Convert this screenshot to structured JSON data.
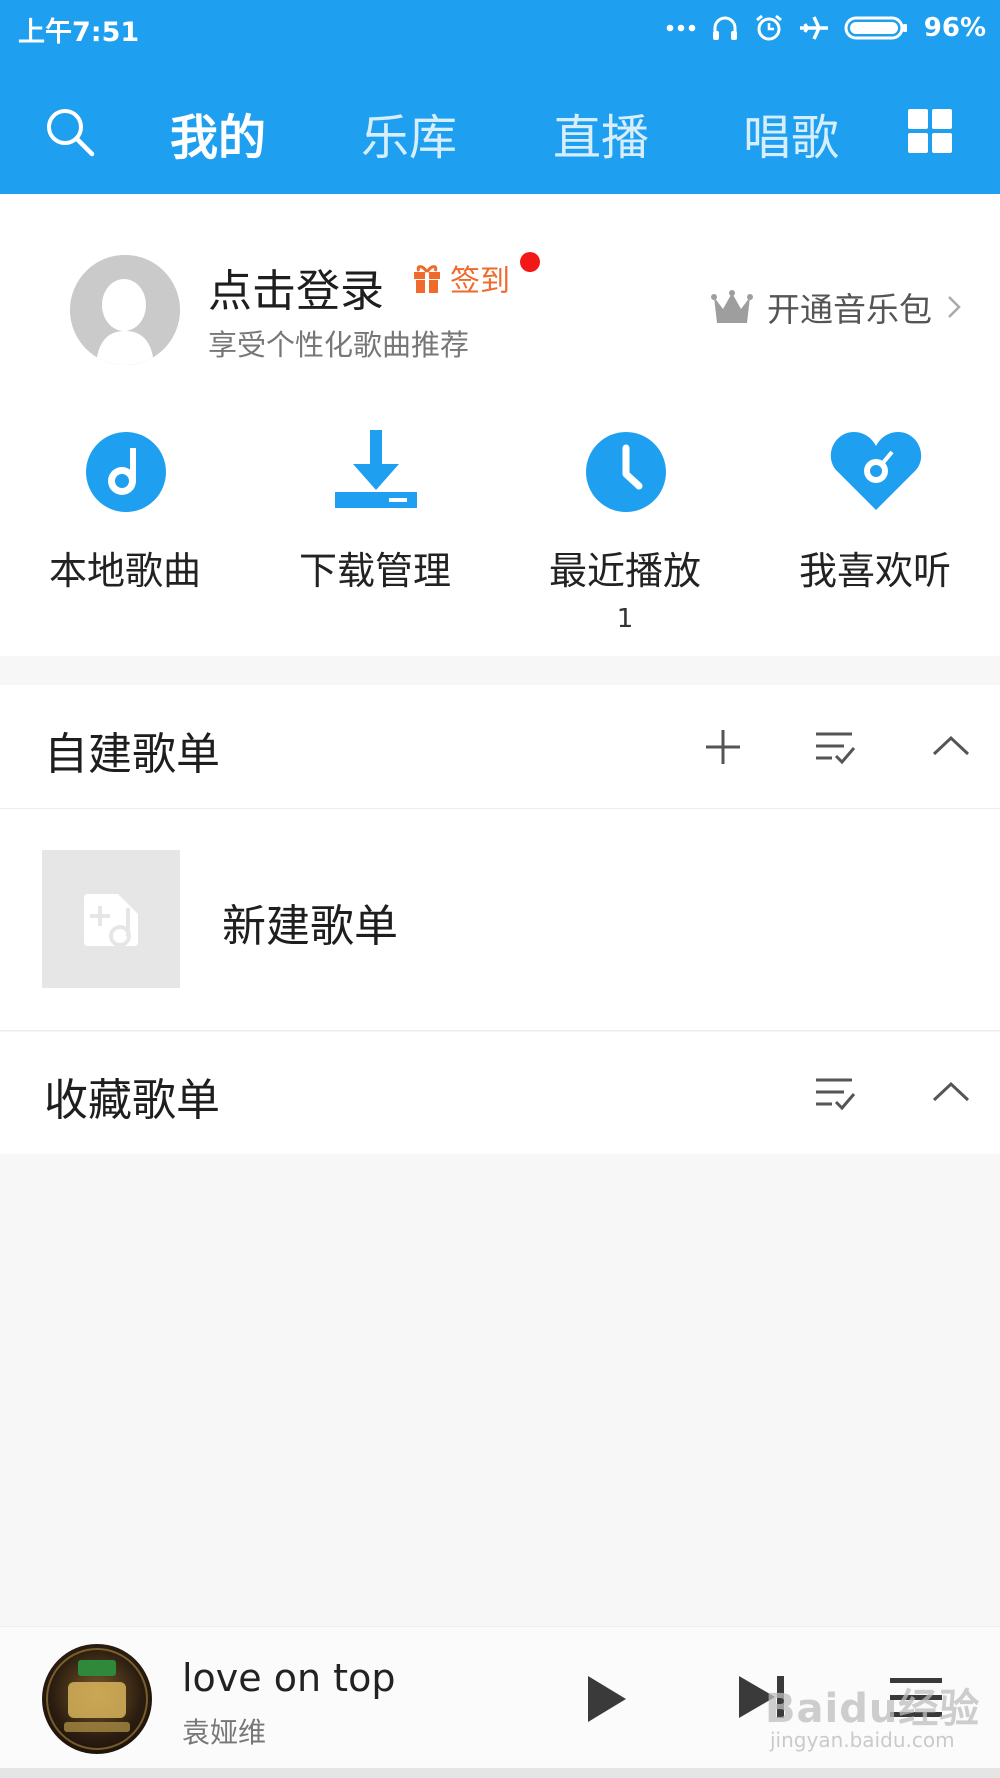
{
  "status_bar": {
    "time": "上午7:51",
    "battery": "96%"
  },
  "nav": {
    "tabs": [
      {
        "label": "我的",
        "active": true
      },
      {
        "label": "乐库",
        "active": false
      },
      {
        "label": "直播",
        "active": false
      },
      {
        "label": "唱歌",
        "active": false
      }
    ],
    "search_icon": "search-icon",
    "menu_icon": "grid-icon"
  },
  "profile": {
    "login_label": "点击登录",
    "signin_label": "签到",
    "subtitle": "享受个性化歌曲推荐",
    "vip_label": "开通音乐包"
  },
  "quick_entries": [
    {
      "label": "本地歌曲",
      "icon": "music-note-disc-icon",
      "count": ""
    },
    {
      "label": "下载管理",
      "icon": "download-icon",
      "count": ""
    },
    {
      "label": "最近播放",
      "icon": "clock-icon",
      "count": "1"
    },
    {
      "label": "我喜欢听",
      "icon": "heart-icon",
      "count": ""
    }
  ],
  "self_playlists": {
    "title": "自建歌单",
    "new_playlist_label": "新建歌单"
  },
  "collected_playlists": {
    "title": "收藏歌单"
  },
  "player": {
    "title": "love on top",
    "artist": "袁娅维"
  },
  "watermark": {
    "text": "Baidu经验",
    "sub": "jingyan.baidu.com"
  },
  "colors": {
    "header_blue": "#1f9ff0",
    "icon_blue": "#1f9ff0",
    "signin_orange": "#f06a2c",
    "badge_red": "#f21818"
  }
}
